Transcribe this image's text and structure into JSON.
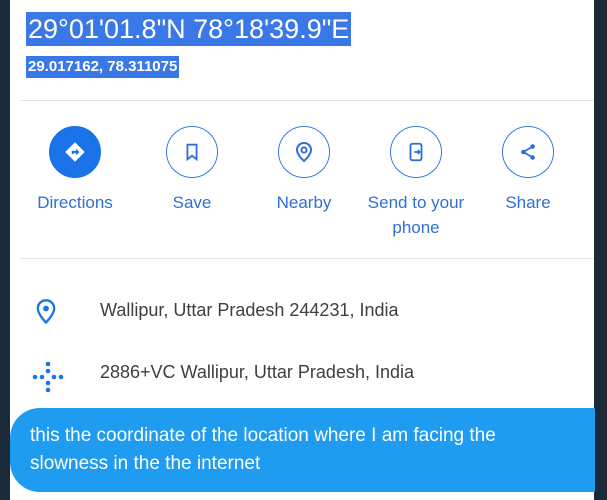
{
  "location": {
    "dms": "29°01'01.8\"N 78°18'39.9\"E",
    "decimal": "29.017162, 78.311075"
  },
  "actions": [
    {
      "label": "Directions",
      "icon": "directions-icon"
    },
    {
      "label": "Save",
      "icon": "bookmark-icon"
    },
    {
      "label": "Nearby",
      "icon": "nearby-icon"
    },
    {
      "label": "Send to your phone",
      "icon": "send-to-phone-icon"
    },
    {
      "label": "Share",
      "icon": "share-icon"
    }
  ],
  "details": {
    "address": "Wallipur, Uttar Pradesh 244231, India",
    "plus_code": "2886+VC Wallipur, Uttar Pradesh, India"
  },
  "message": {
    "text": "this the coordinate of the location where I am facing the slowness in the the internet"
  },
  "colors": {
    "accent": "#1a73e8",
    "selection": "#3b78e7",
    "bubble": "#1f9bef",
    "background": "#1b2a38"
  }
}
